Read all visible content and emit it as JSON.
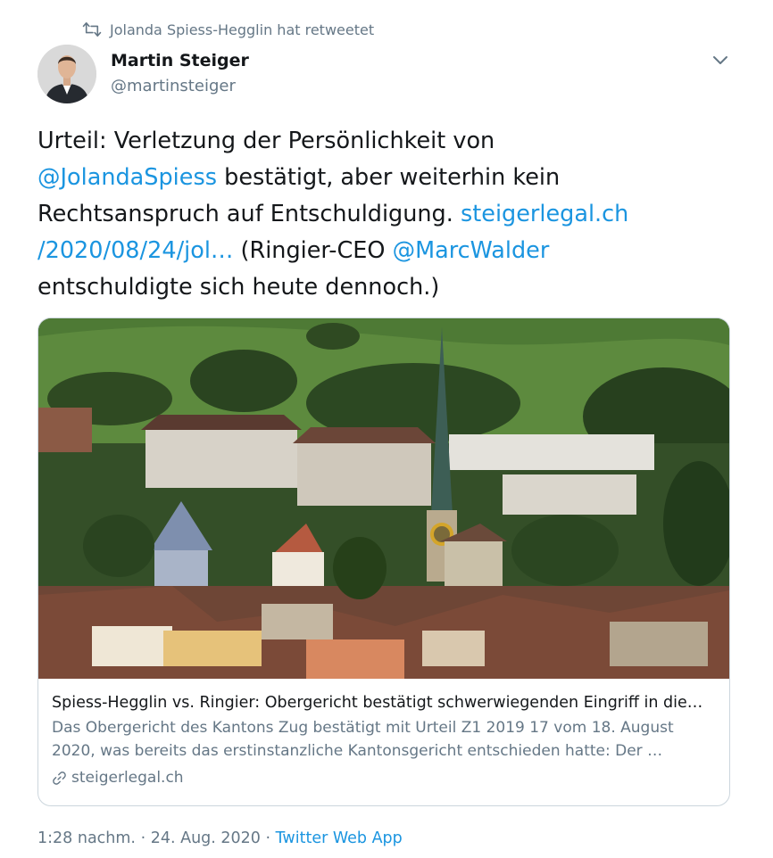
{
  "retweet": {
    "text": "Jolanda Spiess-Hegglin hat retweetet"
  },
  "author": {
    "name": "Martin Steiger",
    "handle": "@martinsteiger"
  },
  "tweet": {
    "line1": "Urteil: Verletzung der Persönlichkeit von",
    "mention1": "@JolandaSpiess",
    "line2_rest": " bestätigt, aber weiterhin kein",
    "line3_text": "Rechtsanspruch auf Entschuldigung. ",
    "link_part1": "steigerlegal.ch",
    "link_part2": "/2020/08/24/jol…",
    "line4_mid": " (Ringier-CEO ",
    "mention2": "@MarcWalder",
    "line5": "entschuldigte sich heute dennoch.)"
  },
  "card": {
    "title": "Spiess-Hegglin vs. Ringier: Obergericht bestätigt schwerwiegenden Eingriff in die…",
    "desc_line1": "Das Obergericht des Kantons Zug bestätigt mit Urteil Z1 2019 17 vom 18. August",
    "desc_line2": "2020, was bereits das erstinstanzliche Kantonsgericht entschieden hatte: Der …",
    "domain": "steigerlegal.ch"
  },
  "meta": {
    "time": "1:28 nachm.",
    "sep1": " · ",
    "date": "24. Aug. 2020",
    "sep2": " · ",
    "source": "Twitter Web App"
  },
  "colors": {
    "link": "#1b95e0",
    "secondary_text": "#657786",
    "primary_text": "#14171a",
    "border": "#ccd6dd"
  },
  "icons": {
    "retweet": "retweet-icon",
    "chevron": "chevron-down-icon",
    "link": "link-icon"
  }
}
